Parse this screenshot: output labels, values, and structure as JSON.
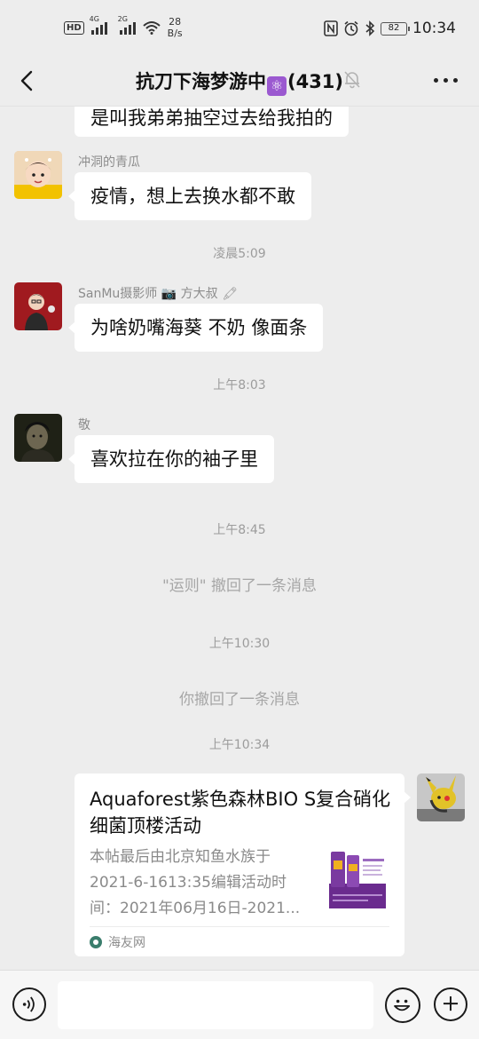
{
  "status_bar": {
    "hd_label": "HD",
    "sig1_label": "4G",
    "sig2_label": "2G",
    "speed_value": "28",
    "speed_unit": "B/s",
    "battery": "82",
    "time": "10:34"
  },
  "header": {
    "title_prefix": "抗刀下海梦游中",
    "title_emoji": "⚛",
    "title_count": "(431)"
  },
  "messages": {
    "m0_text": "是叫我弟弟抽空过去给我拍的",
    "m1_sender": "冲洞的青瓜",
    "m1_text": "疫情，想上去换水都不敢",
    "t1": "凌晨5:09",
    "m2_sender": "SanMu摄影师 📷 方大叔 🖍",
    "m2_text": "为啥奶嘴海葵 不奶 像面条",
    "t2": "上午8:03",
    "m3_sender": "敬",
    "m3_text": "喜欢拉在你的袖子里",
    "t3": "上午8:45",
    "sys1": "\"运则\" 撤回了一条消息",
    "t4": "上午10:30",
    "sys2": "你撤回了一条消息",
    "t5": "上午10:34"
  },
  "card": {
    "title": "Aquaforest紫色森林BIO S复合硝化细菌顶楼活动",
    "desc": "本帖最后由北京知鱼水族于2021-6-1613:35编辑活动时间：2021年06月16日-2021...",
    "source": "海友网"
  },
  "input": {
    "placeholder": ""
  }
}
